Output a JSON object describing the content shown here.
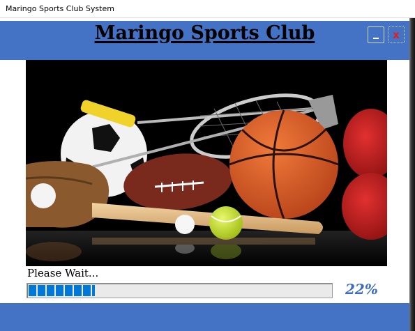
{
  "window": {
    "title": "Maringo Sports Club System"
  },
  "header": {
    "title": "Maringo Sports Club",
    "minimize_label": "_",
    "close_label": "x",
    "background_color": "#4472c4"
  },
  "hero": {
    "description": "sports equipment photo",
    "icon": "sports-equipment-image"
  },
  "status": {
    "wait_text": "Please Wait...",
    "progress_percent": 22,
    "progress_label": "22%",
    "progress_color": "#0078d7"
  }
}
